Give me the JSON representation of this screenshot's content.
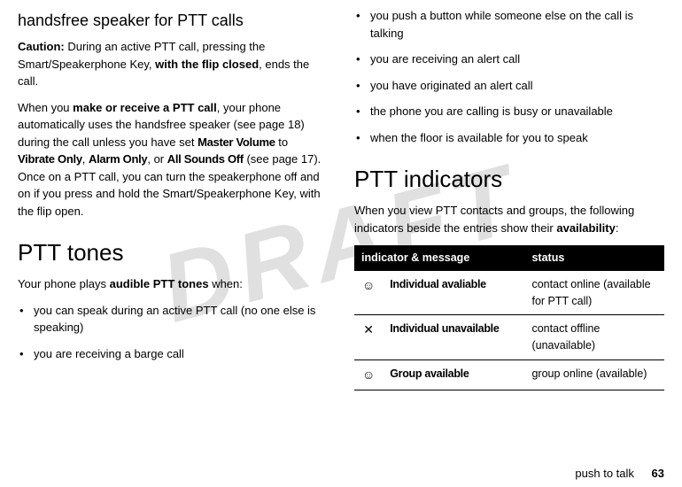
{
  "watermark": "DRAFT",
  "left": {
    "h2_handsfree": "handsfree speaker for PTT calls",
    "caution_label": "Caution:",
    "caution_text_1": " During an active PTT call, pressing the Smart/Speakerphone Key, ",
    "caution_bold": "with the flip closed",
    "caution_text_2": ", ends the call.",
    "p2_a": "When you ",
    "p2_bold": "make or receive a PTT call",
    "p2_b": ", your phone automatically uses the handsfree speaker (see page 18) during the call unless you have set ",
    "p2_master": "Master Volume",
    "p2_c": " to ",
    "p2_vibrate": "Vibrate Only",
    "p2_d": ", ",
    "p2_alarm": "Alarm Only",
    "p2_e": ", or ",
    "p2_allsounds": "All Sounds Off",
    "p2_f": " (see page 17). Once on a PTT call, you can turn the speakerphone off and on if you press and hold the Smart/Speakerphone Key, with the flip open.",
    "h1_tones": "PTT tones",
    "tones_intro_a": "Your phone plays ",
    "tones_intro_bold": "audible PTT tones",
    "tones_intro_b": " when:",
    "tones_items": [
      "you can speak during an active PTT call (no one else is speaking)",
      "you are receiving a barge call"
    ]
  },
  "right": {
    "tones_items_cont": [
      "you push a button while someone else on the call is talking",
      "you are receiving an alert call",
      "you have originated an alert call",
      "the phone you are calling is busy or unavailable",
      "when the floor is available for you to speak"
    ],
    "h1_indicators": "PTT indicators",
    "ind_intro_a": "When you view PTT contacts and groups, the following indicators beside the entries show their ",
    "ind_intro_bold": "availability",
    "ind_intro_b": ":",
    "table": {
      "head_indicator": "indicator & message",
      "head_status": "status",
      "rows": [
        {
          "icon": "☺",
          "msg": "Individual avaliable",
          "status": "contact online (available for PTT call)"
        },
        {
          "icon": "✕",
          "msg": "Individual unavailable",
          "status": "contact offline (unavailable)"
        },
        {
          "icon": "☺",
          "msg": "Group available",
          "status": "group online (available)"
        }
      ]
    }
  },
  "footer": {
    "section": "push to talk",
    "page": "63"
  }
}
